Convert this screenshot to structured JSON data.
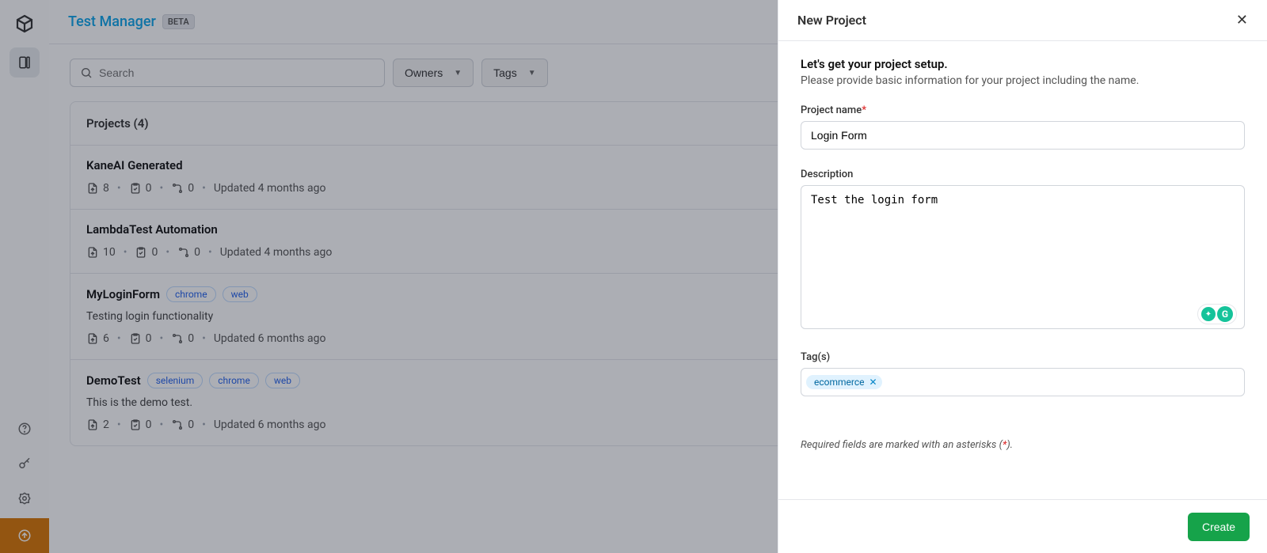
{
  "header": {
    "title": "Test Manager",
    "badge": "BETA"
  },
  "toolbar": {
    "search_placeholder": "Search",
    "owners_label": "Owners",
    "tags_label": "Tags"
  },
  "list": {
    "header": "Projects (4)",
    "projects": [
      {
        "name": "KaneAI Generated",
        "desc": "",
        "tags": [],
        "c1": "8",
        "c2": "0",
        "c3": "0",
        "updated": "Updated 4 months ago"
      },
      {
        "name": "LambdaTest Automation",
        "desc": "",
        "tags": [],
        "c1": "10",
        "c2": "0",
        "c3": "0",
        "updated": "Updated 4 months ago"
      },
      {
        "name": "MyLoginForm",
        "desc": "Testing login functionality",
        "tags": [
          "chrome",
          "web"
        ],
        "c1": "6",
        "c2": "0",
        "c3": "0",
        "updated": "Updated 6 months ago"
      },
      {
        "name": "DemoTest",
        "desc": "This is the demo test.",
        "tags": [
          "selenium",
          "chrome",
          "web"
        ],
        "c1": "2",
        "c2": "0",
        "c3": "0",
        "updated": "Updated 6 months ago"
      }
    ]
  },
  "drawer": {
    "title": "New Project",
    "lead": "Let's get your project setup.",
    "lead_sub": "Please provide basic information for your project including the name.",
    "name_label": "Project name",
    "name_value": "Login Form",
    "desc_label": "Description",
    "desc_value": "Test the login form",
    "tags_label": "Tag(s)",
    "tag_chip": "ecommerce",
    "required_note_prefix": "Required fields are marked with an asterisks (",
    "required_note_suffix": ").",
    "create_label": "Create"
  }
}
